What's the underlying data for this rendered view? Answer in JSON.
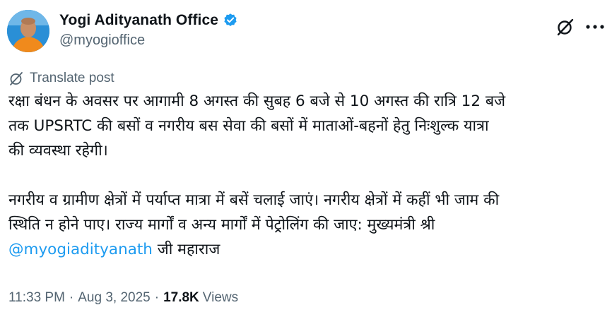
{
  "author": {
    "display_name": "Yogi Adityanath Office",
    "handle": "@myogioffice",
    "verified": true
  },
  "translate_label": "Translate post",
  "post": {
    "para1": [
      "रक्षा बंधन के अवसर पर आगामी 8 अगस्त की सुबह 6 बजे से 10 अगस्त की रात्रि 12 बजे",
      "तक UPSRTC की बसों व नगरीय बस सेवा की बसों में माताओं-बहनों हेतु निःशुल्क यात्रा",
      "की व्यवस्था रहेगी।"
    ],
    "para2": [
      "नगरीय व ग्रामीण क्षेत्रों में पर्याप्त मात्रा में बसें चलाई जाएं। नगरीय क्षेत्रों में कहीं भी जाम की",
      "स्थिति न होने पाए। राज्य मार्गों व अन्य मार्गों में पेट्रोलिंग की जाए: मुख्यमंत्री श्री"
    ],
    "mention": "@myogiadityanath",
    "mention_suffix": " जी महाराज"
  },
  "meta": {
    "time": "11:33 PM",
    "separator": "·",
    "date": "Aug 3, 2025",
    "views_count": "17.8K",
    "views_label": "Views"
  },
  "colors": {
    "accent": "#1d9bf0",
    "text": "#0f1419",
    "muted": "#536471"
  }
}
